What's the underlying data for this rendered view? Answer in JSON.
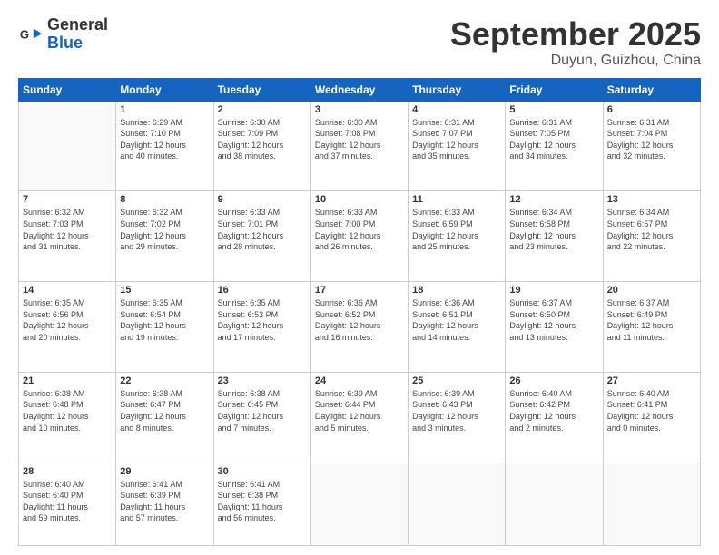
{
  "header": {
    "logo_line1": "General",
    "logo_line2": "Blue",
    "month": "September 2025",
    "location": "Duyun, Guizhou, China"
  },
  "weekdays": [
    "Sunday",
    "Monday",
    "Tuesday",
    "Wednesday",
    "Thursday",
    "Friday",
    "Saturday"
  ],
  "weeks": [
    [
      {
        "day": "",
        "info": ""
      },
      {
        "day": "1",
        "info": "Sunrise: 6:29 AM\nSunset: 7:10 PM\nDaylight: 12 hours\nand 40 minutes."
      },
      {
        "day": "2",
        "info": "Sunrise: 6:30 AM\nSunset: 7:09 PM\nDaylight: 12 hours\nand 38 minutes."
      },
      {
        "day": "3",
        "info": "Sunrise: 6:30 AM\nSunset: 7:08 PM\nDaylight: 12 hours\nand 37 minutes."
      },
      {
        "day": "4",
        "info": "Sunrise: 6:31 AM\nSunset: 7:07 PM\nDaylight: 12 hours\nand 35 minutes."
      },
      {
        "day": "5",
        "info": "Sunrise: 6:31 AM\nSunset: 7:05 PM\nDaylight: 12 hours\nand 34 minutes."
      },
      {
        "day": "6",
        "info": "Sunrise: 6:31 AM\nSunset: 7:04 PM\nDaylight: 12 hours\nand 32 minutes."
      }
    ],
    [
      {
        "day": "7",
        "info": "Sunrise: 6:32 AM\nSunset: 7:03 PM\nDaylight: 12 hours\nand 31 minutes."
      },
      {
        "day": "8",
        "info": "Sunrise: 6:32 AM\nSunset: 7:02 PM\nDaylight: 12 hours\nand 29 minutes."
      },
      {
        "day": "9",
        "info": "Sunrise: 6:33 AM\nSunset: 7:01 PM\nDaylight: 12 hours\nand 28 minutes."
      },
      {
        "day": "10",
        "info": "Sunrise: 6:33 AM\nSunset: 7:00 PM\nDaylight: 12 hours\nand 26 minutes."
      },
      {
        "day": "11",
        "info": "Sunrise: 6:33 AM\nSunset: 6:59 PM\nDaylight: 12 hours\nand 25 minutes."
      },
      {
        "day": "12",
        "info": "Sunrise: 6:34 AM\nSunset: 6:58 PM\nDaylight: 12 hours\nand 23 minutes."
      },
      {
        "day": "13",
        "info": "Sunrise: 6:34 AM\nSunset: 6:57 PM\nDaylight: 12 hours\nand 22 minutes."
      }
    ],
    [
      {
        "day": "14",
        "info": "Sunrise: 6:35 AM\nSunset: 6:56 PM\nDaylight: 12 hours\nand 20 minutes."
      },
      {
        "day": "15",
        "info": "Sunrise: 6:35 AM\nSunset: 6:54 PM\nDaylight: 12 hours\nand 19 minutes."
      },
      {
        "day": "16",
        "info": "Sunrise: 6:35 AM\nSunset: 6:53 PM\nDaylight: 12 hours\nand 17 minutes."
      },
      {
        "day": "17",
        "info": "Sunrise: 6:36 AM\nSunset: 6:52 PM\nDaylight: 12 hours\nand 16 minutes."
      },
      {
        "day": "18",
        "info": "Sunrise: 6:36 AM\nSunset: 6:51 PM\nDaylight: 12 hours\nand 14 minutes."
      },
      {
        "day": "19",
        "info": "Sunrise: 6:37 AM\nSunset: 6:50 PM\nDaylight: 12 hours\nand 13 minutes."
      },
      {
        "day": "20",
        "info": "Sunrise: 6:37 AM\nSunset: 6:49 PM\nDaylight: 12 hours\nand 11 minutes."
      }
    ],
    [
      {
        "day": "21",
        "info": "Sunrise: 6:38 AM\nSunset: 6:48 PM\nDaylight: 12 hours\nand 10 minutes."
      },
      {
        "day": "22",
        "info": "Sunrise: 6:38 AM\nSunset: 6:47 PM\nDaylight: 12 hours\nand 8 minutes."
      },
      {
        "day": "23",
        "info": "Sunrise: 6:38 AM\nSunset: 6:45 PM\nDaylight: 12 hours\nand 7 minutes."
      },
      {
        "day": "24",
        "info": "Sunrise: 6:39 AM\nSunset: 6:44 PM\nDaylight: 12 hours\nand 5 minutes."
      },
      {
        "day": "25",
        "info": "Sunrise: 6:39 AM\nSunset: 6:43 PM\nDaylight: 12 hours\nand 3 minutes."
      },
      {
        "day": "26",
        "info": "Sunrise: 6:40 AM\nSunset: 6:42 PM\nDaylight: 12 hours\nand 2 minutes."
      },
      {
        "day": "27",
        "info": "Sunrise: 6:40 AM\nSunset: 6:41 PM\nDaylight: 12 hours\nand 0 minutes."
      }
    ],
    [
      {
        "day": "28",
        "info": "Sunrise: 6:40 AM\nSunset: 6:40 PM\nDaylight: 11 hours\nand 59 minutes."
      },
      {
        "day": "29",
        "info": "Sunrise: 6:41 AM\nSunset: 6:39 PM\nDaylight: 11 hours\nand 57 minutes."
      },
      {
        "day": "30",
        "info": "Sunrise: 6:41 AM\nSunset: 6:38 PM\nDaylight: 11 hours\nand 56 minutes."
      },
      {
        "day": "",
        "info": ""
      },
      {
        "day": "",
        "info": ""
      },
      {
        "day": "",
        "info": ""
      },
      {
        "day": "",
        "info": ""
      }
    ]
  ]
}
